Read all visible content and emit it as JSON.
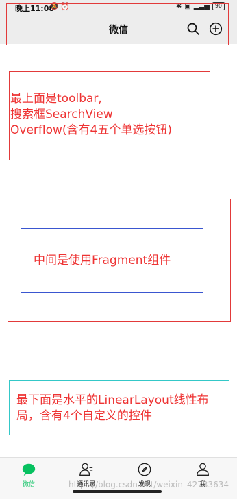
{
  "status_bar": {
    "time": "晚上11:08",
    "battery": "90"
  },
  "toolbar": {
    "title": "微信"
  },
  "annotations": {
    "top": "最上面是toolbar,\n搜索框SearchView\nOverflow(含有4五个单选按钮)",
    "middle": "中间是使用Fragment组件",
    "bottom": "最下面是水平的LinearLayout线性布局，含有4个自定义的控件"
  },
  "bottom_nav": {
    "items": [
      {
        "label": "微信",
        "icon": "chat-icon",
        "active": true
      },
      {
        "label": "通讯录",
        "icon": "contacts-icon",
        "active": false
      },
      {
        "label": "发现",
        "icon": "compass-icon",
        "active": false
      },
      {
        "label": "我",
        "icon": "person-icon",
        "active": false
      }
    ]
  },
  "watermark": "https://blog.csdn.net/weixin_42733634",
  "colors": {
    "accent": "#07c160",
    "annotation_red": "#ee3333",
    "frame_blue": "#3a56d0",
    "frame_cyan": "#34c8c8"
  }
}
